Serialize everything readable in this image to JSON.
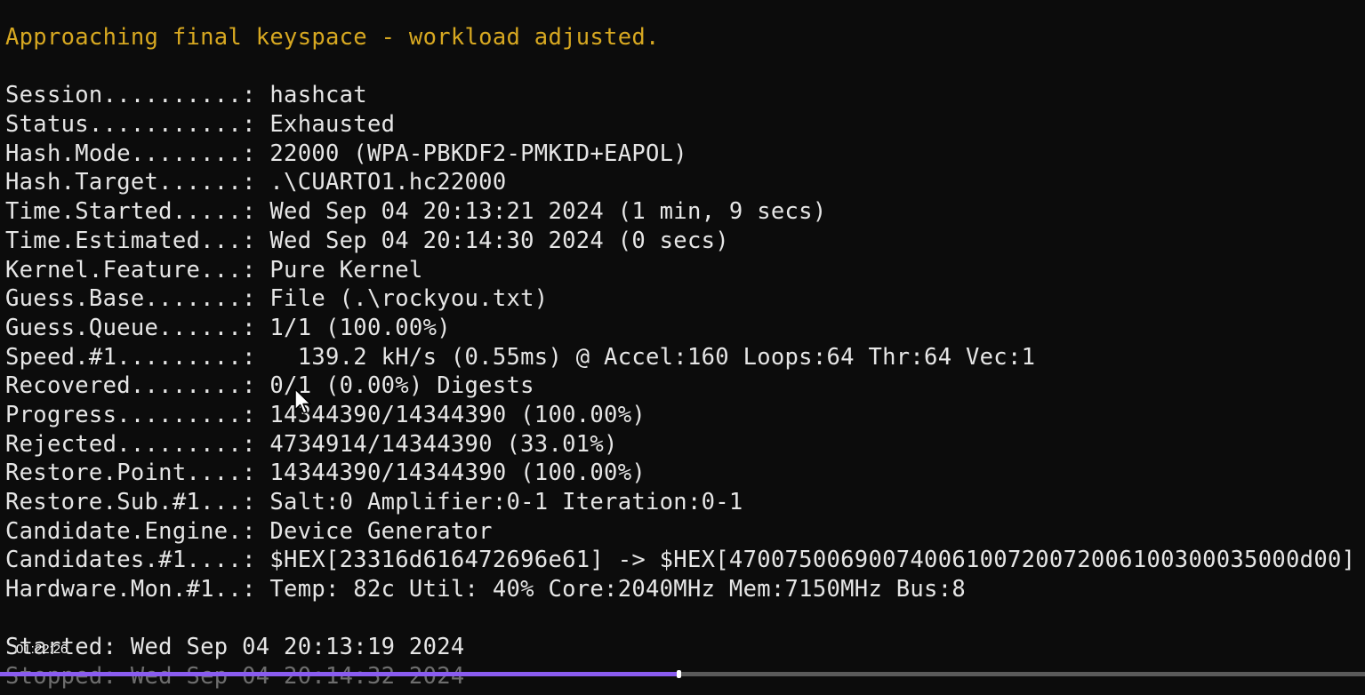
{
  "terminal": {
    "warning": "Approaching final keyspace - workload adjusted.",
    "lines": [
      "Session..........: hashcat",
      "Status...........: Exhausted",
      "Hash.Mode........: 22000 (WPA-PBKDF2-PMKID+EAPOL)",
      "Hash.Target......: .\\CUARTO1.hc22000",
      "Time.Started.....: Wed Sep 04 20:13:21 2024 (1 min, 9 secs)",
      "Time.Estimated...: Wed Sep 04 20:14:30 2024 (0 secs)",
      "Kernel.Feature...: Pure Kernel",
      "Guess.Base.......: File (.\\rockyou.txt)",
      "Guess.Queue......: 1/1 (100.00%)",
      "Speed.#1.........:   139.2 kH/s (0.55ms) @ Accel:160 Loops:64 Thr:64 Vec:1",
      "Recovered........: 0/1 (0.00%) Digests",
      "Progress.........: 14344390/14344390 (100.00%)",
      "Rejected.........: 4734914/14344390 (33.01%)",
      "Restore.Point....: 14344390/14344390 (100.00%)",
      "Restore.Sub.#1...: Salt:0 Amplifier:0-1 Iteration:0-1",
      "Candidate.Engine.: Device Generator",
      "Candidates.#1....: $HEX[23316d616472696e61] -> $HEX[47007500690074006100720072006100300035000d00]",
      "Hardware.Mon.#1..: Temp: 82c Util: 40% Core:2040MHz Mem:7150MHz Bus:8"
    ],
    "started": "Started: Wed Sep 04 20:13:19 2024",
    "stopped": "Stopped: Wed Sep 04 20:14:32 2024"
  },
  "video": {
    "timestamp": "01:22:26",
    "progress_fraction": 0.497
  },
  "colors": {
    "background": "#0c0c0c",
    "text": "#e6e6e6",
    "warning": "#d7a821",
    "progress_fill": "#8a5cf0"
  }
}
